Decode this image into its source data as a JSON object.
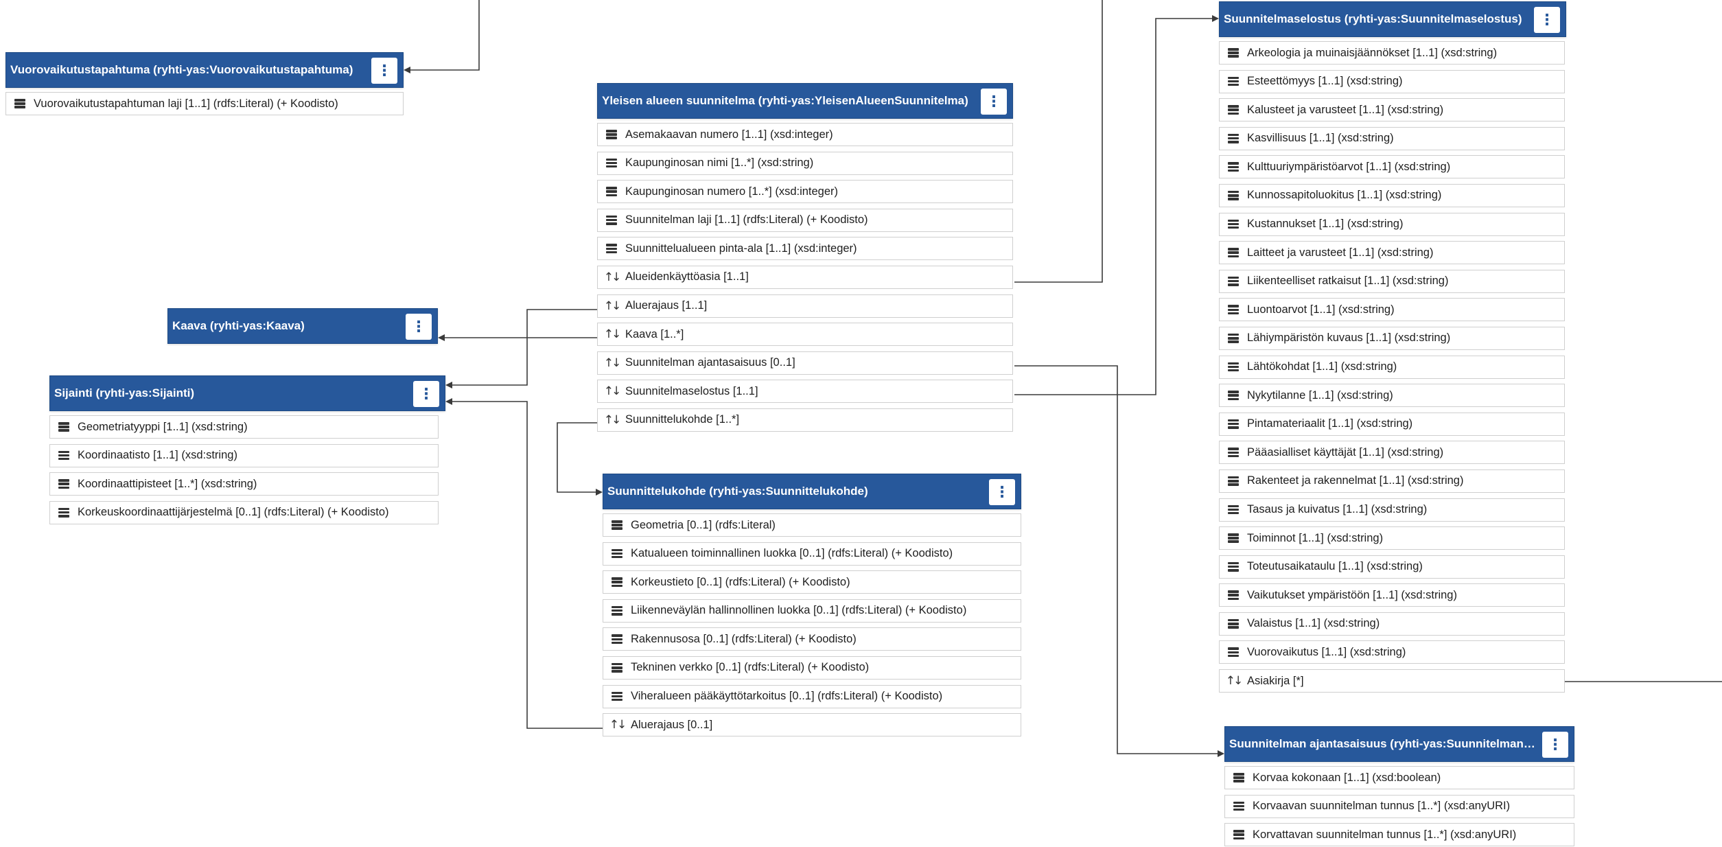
{
  "diagram": {
    "classes": [
      {
        "id": "vuorovaikutus",
        "title": "Vuorovaikutustapahtuma (ryhti-yas:Vuorovaikutustapahtuma)",
        "rows": [
          {
            "kind": "attr",
            "label": "Vuorovaikutustapahtuman laji [1..1] (rdfs:Literal) (+ Koodisto)"
          }
        ]
      },
      {
        "id": "kaava",
        "title": "Kaava (ryhti-yas:Kaava)",
        "rows": []
      },
      {
        "id": "sijainti",
        "title": "Sijainti (ryhti-yas:Sijainti)",
        "rows": [
          {
            "kind": "attr",
            "label": "Geometriatyyppi [1..1] (xsd:string)"
          },
          {
            "kind": "attr",
            "label": "Koordinaatisto [1..1] (xsd:string)"
          },
          {
            "kind": "attr",
            "label": "Koordinaattipisteet [1..*] (xsd:string)"
          },
          {
            "kind": "attr",
            "label": "Korkeuskoordinaattijärjestelmä [0..1] (rdfs:Literal) (+ Koodisto)"
          }
        ]
      },
      {
        "id": "yleinen",
        "title": "Yleisen alueen suunnitelma (ryhti-yas:YleisenAlueenSuunnitelma)",
        "rows": [
          {
            "kind": "attr",
            "label": "Asemakaavan numero [1..1] (xsd:integer)"
          },
          {
            "kind": "attr",
            "label": "Kaupunginosan nimi [1..*] (xsd:string)"
          },
          {
            "kind": "attr",
            "label": "Kaupunginosan numero [1..*] (xsd:integer)"
          },
          {
            "kind": "attr",
            "label": "Suunnitelman laji [1..1] (rdfs:Literal) (+ Koodisto)"
          },
          {
            "kind": "attr",
            "label": "Suunnittelualueen pinta-ala [1..1] (xsd:integer)"
          },
          {
            "kind": "rel",
            "label": "Alueidenkäyttöasia [1..1]"
          },
          {
            "kind": "rel",
            "label": "Aluerajaus [1..1]"
          },
          {
            "kind": "rel",
            "label": "Kaava [1..*]"
          },
          {
            "kind": "rel",
            "label": "Suunnitelman ajantasaisuus [0..1]"
          },
          {
            "kind": "rel",
            "label": "Suunnitelmaselostus [1..1]"
          },
          {
            "kind": "rel",
            "label": "Suunnittelukohde [1..*]"
          }
        ]
      },
      {
        "id": "kohde",
        "title": "Suunnittelukohde (ryhti-yas:Suunnittelukohde)",
        "rows": [
          {
            "kind": "attr",
            "label": "Geometria [0..1] (rdfs:Literal)"
          },
          {
            "kind": "attr",
            "label": "Katualueen toiminnallinen luokka [0..1] (rdfs:Literal) (+ Koodisto)"
          },
          {
            "kind": "attr",
            "label": "Korkeustieto [0..1] (rdfs:Literal) (+ Koodisto)"
          },
          {
            "kind": "attr",
            "label": "Liikenneväylän hallinnollinen luokka [0..1] (rdfs:Literal) (+ Koodisto)"
          },
          {
            "kind": "attr",
            "label": "Rakennusosa [0..1] (rdfs:Literal) (+ Koodisto)"
          },
          {
            "kind": "attr",
            "label": "Tekninen verkko [0..1] (rdfs:Literal) (+ Koodisto)"
          },
          {
            "kind": "attr",
            "label": "Viheralueen pääkäyttötarkoitus [0..1] (rdfs:Literal) (+ Koodisto)"
          },
          {
            "kind": "rel",
            "label": "Aluerajaus [0..1]"
          }
        ]
      },
      {
        "id": "selostus",
        "title": "Suunnitelmaselostus (ryhti-yas:Suunnitelmaselostus)",
        "rows": [
          {
            "kind": "attr",
            "label": "Arkeologia ja muinaisjäännökset [1..1] (xsd:string)"
          },
          {
            "kind": "attr",
            "label": "Esteettömyys [1..1] (xsd:string)"
          },
          {
            "kind": "attr",
            "label": "Kalusteet ja varusteet [1..1] (xsd:string)"
          },
          {
            "kind": "attr",
            "label": "Kasvillisuus [1..1] (xsd:string)"
          },
          {
            "kind": "attr",
            "label": "Kulttuuriympäristöarvot [1..1] (xsd:string)"
          },
          {
            "kind": "attr",
            "label": "Kunnossapitoluokitus [1..1] (xsd:string)"
          },
          {
            "kind": "attr",
            "label": "Kustannukset [1..1] (xsd:string)"
          },
          {
            "kind": "attr",
            "label": "Laitteet ja varusteet [1..1] (xsd:string)"
          },
          {
            "kind": "attr",
            "label": "Liikenteelliset ratkaisut [1..1] (xsd:string)"
          },
          {
            "kind": "attr",
            "label": "Luontoarvot [1..1] (xsd:string)"
          },
          {
            "kind": "attr",
            "label": "Lähiympäristön kuvaus [1..1] (xsd:string)"
          },
          {
            "kind": "attr",
            "label": "Lähtökohdat [1..1] (xsd:string)"
          },
          {
            "kind": "attr",
            "label": "Nykytilanne [1..1] (xsd:string)"
          },
          {
            "kind": "attr",
            "label": "Pintamateriaalit [1..1] (xsd:string)"
          },
          {
            "kind": "attr",
            "label": "Pääasialliset käyttäjät [1..1] (xsd:string)"
          },
          {
            "kind": "attr",
            "label": "Rakenteet ja rakennelmat [1..1] (xsd:string)"
          },
          {
            "kind": "attr",
            "label": "Tasaus ja kuivatus [1..1] (xsd:string)"
          },
          {
            "kind": "attr",
            "label": "Toiminnot [1..1] (xsd:string)"
          },
          {
            "kind": "attr",
            "label": "Toteutusaikataulu [1..1] (xsd:string)"
          },
          {
            "kind": "attr",
            "label": "Vaikutukset ympäristöön [1..1] (xsd:string)"
          },
          {
            "kind": "attr",
            "label": "Valaistus [1..1] (xsd:string)"
          },
          {
            "kind": "attr",
            "label": "Vuorovaikutus [1..1] (xsd:string)"
          },
          {
            "kind": "rel",
            "label": "Asiakirja [*]"
          }
        ]
      },
      {
        "id": "ajantasaisuus",
        "title": "Suunnitelman ajantasaisuus (ryhti-yas:SuunnitelmanAjantasaisuus)",
        "rows": [
          {
            "kind": "attr",
            "label": "Korvaa kokonaan [1..1] (xsd:boolean)"
          },
          {
            "kind": "attr",
            "label": "Korvaavan suunnitelman tunnus [1..*] (xsd:anyURI)"
          },
          {
            "kind": "attr",
            "label": "Korvattavan suunnitelman tunnus [1..*] (xsd:anyURI)"
          }
        ]
      }
    ]
  },
  "icons": {
    "menu": "more-vertical-icon",
    "attribute": "attribute-icon",
    "association": "association-icon"
  },
  "colors": {
    "header": "#27589b",
    "header_text": "#ffffff",
    "row_border": "#cfcfcf",
    "connector": "#3a3a3a"
  }
}
